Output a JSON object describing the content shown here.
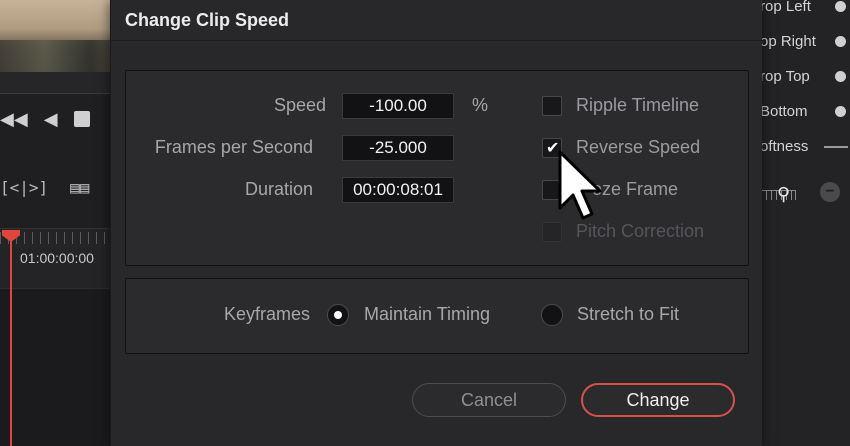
{
  "background": {
    "timeline": {
      "timecode": "01:00:00:00"
    },
    "inspector": {
      "rows": [
        {
          "label": "rop Left",
          "control": "dot"
        },
        {
          "label": "op Right",
          "control": "dot"
        },
        {
          "label": "rop Top",
          "control": "dot"
        },
        {
          "label": "Bottom",
          "control": "dot"
        },
        {
          "label": "oftness",
          "control": "line"
        }
      ]
    }
  },
  "dialog": {
    "title": "Change Clip Speed",
    "fields": {
      "speed": {
        "label": "Speed",
        "value": "-100.00",
        "unit": "%"
      },
      "fps": {
        "label": "Frames per Second",
        "value": "-25.000"
      },
      "duration": {
        "label": "Duration",
        "value": "00:00:08:01"
      }
    },
    "options": [
      {
        "label": "Ripple Timeline",
        "checked": false,
        "disabled": false
      },
      {
        "label": "Reverse Speed",
        "checked": true,
        "disabled": false
      },
      {
        "label": "eze Frame",
        "checked": false,
        "disabled": false
      },
      {
        "label": "Pitch Correction",
        "checked": false,
        "disabled": true
      }
    ],
    "keyframes": {
      "label": "Keyframes",
      "maintain_timing": {
        "label": "Maintain Timing",
        "selected": true
      },
      "stretch_to_fit": {
        "label": "Stretch to Fit",
        "selected": false
      }
    },
    "buttons": {
      "cancel": "Cancel",
      "change": "Change"
    },
    "colors": {
      "accent": "#d5524a",
      "playhead": "#e0463a"
    }
  }
}
